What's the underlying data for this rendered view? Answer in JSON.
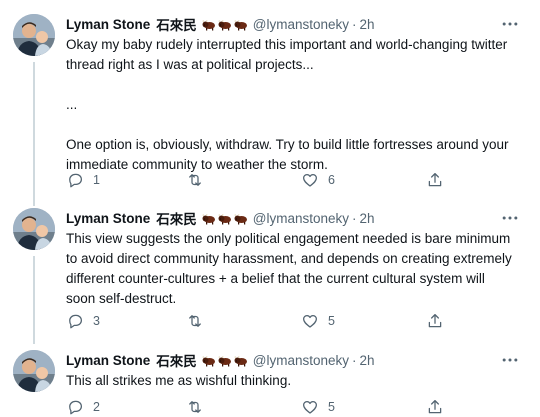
{
  "tweets": [
    {
      "name": "Lyman Stone",
      "name_cjk": "石來民",
      "handle": "@lymanstoneky",
      "dot": "·",
      "time": "2h",
      "text": [
        "Okay my baby rudely interrupted this important and world-changing twitter",
        "thread right as I was at political projects...",
        "",
        "...",
        "",
        "One option is, obviously, withdraw. Try to build little fortresses around your",
        "immediate community to weather the storm."
      ],
      "replies": "1",
      "retweets": "",
      "likes": "6"
    },
    {
      "name": "Lyman Stone",
      "name_cjk": "石來民",
      "handle": "@lymanstoneky",
      "dot": "·",
      "time": "2h",
      "text": [
        "This view suggests the only political engagement needed is bare minimum",
        "to avoid direct community harassment, and depends on creating extremely",
        "different counter-cultures + a belief that the current cultural system will",
        "soon self-destruct."
      ],
      "replies": "3",
      "retweets": "",
      "likes": "5"
    },
    {
      "name": "Lyman Stone",
      "name_cjk": "石來民",
      "handle": "@lymanstoneky",
      "dot": "·",
      "time": "2h",
      "text": [
        "This all strikes me as wishful thinking."
      ],
      "replies": "2",
      "retweets": "",
      "likes": "5"
    }
  ],
  "icons": {
    "avatar": "avatar-photo",
    "emoji": "bison-emoji",
    "more": "more-icon",
    "reply": "reply-icon",
    "retweet": "retweet-icon",
    "like": "like-icon",
    "share": "share-icon"
  },
  "colors": {
    "text": "#0f1419",
    "secondary": "#536471",
    "thread_line": "#cfd9de",
    "bison": "#6b2a14"
  }
}
